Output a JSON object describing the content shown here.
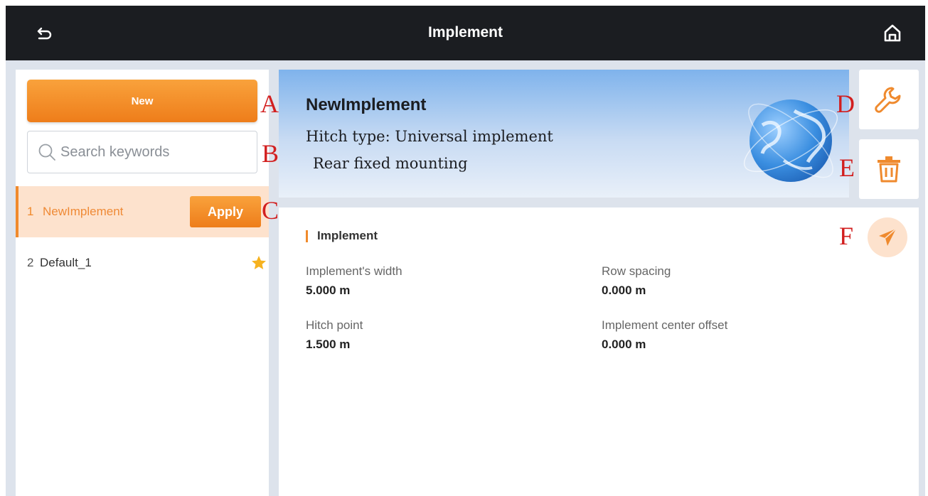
{
  "header": {
    "title": "Implement",
    "back_icon": "back-arrow-icon",
    "home_icon": "home-icon"
  },
  "sidebar": {
    "new_label": "New",
    "search_placeholder": "Search keywords",
    "items": [
      {
        "index": "1",
        "name": "NewImplement",
        "action": "Apply",
        "active": true
      },
      {
        "index": "2",
        "name": "Default_1",
        "favorite": true
      }
    ]
  },
  "summary": {
    "name": "NewImplement",
    "hitch_type": "Hitch type: Universal implement",
    "mounting": "Rear fixed mounting"
  },
  "details": {
    "section_title": "Implement",
    "fields": [
      {
        "label": "Implement's width",
        "value": "5.000 m"
      },
      {
        "label": "Row spacing",
        "value": "0.000 m"
      },
      {
        "label": "Hitch point",
        "value": "1.500 m"
      },
      {
        "label": "Implement center offset",
        "value": "0.000 m"
      }
    ]
  },
  "markers": [
    "A",
    "B",
    "C",
    "D",
    "E",
    "F"
  ],
  "colors": {
    "accent": "#f08a2c",
    "topbar": "#1b1d21",
    "annotation": "#d21f1f"
  }
}
